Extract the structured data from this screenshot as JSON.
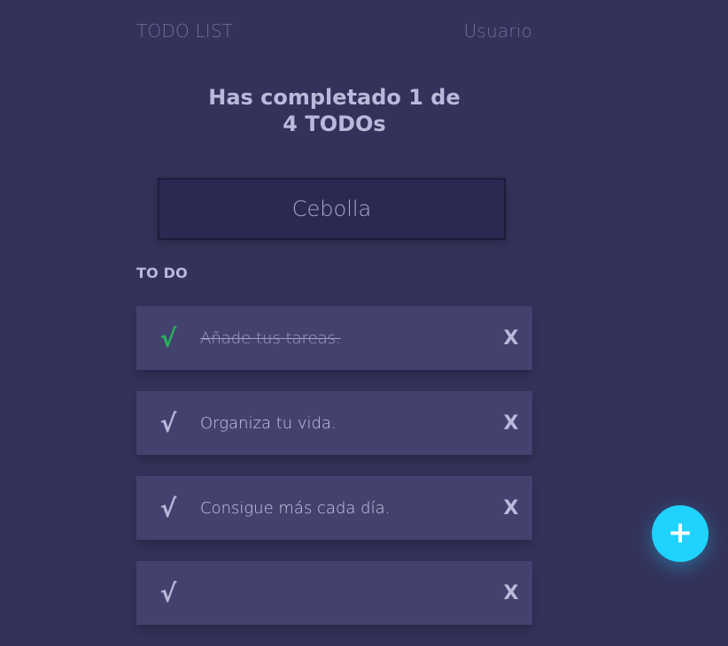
{
  "header": {
    "brand": "TODO LIST",
    "user": "Usuario"
  },
  "summary": {
    "title": "Has completado 1 de 4 TODOs",
    "completed": 1,
    "total": 4
  },
  "search": {
    "value": "Cebolla",
    "placeholder": ""
  },
  "todo": {
    "section_label": "TO DO",
    "items": [
      {
        "label": "Añade tus tareas.",
        "completed": true,
        "check_symbol": "√",
        "delete_symbol": "X"
      },
      {
        "label": "Organiza tu vida.",
        "completed": false,
        "check_symbol": "√",
        "delete_symbol": "X"
      },
      {
        "label": "Consigue más cada día.",
        "completed": false,
        "check_symbol": "√",
        "delete_symbol": "X"
      },
      {
        "label": "",
        "completed": false,
        "check_symbol": "√",
        "delete_symbol": "X"
      }
    ]
  },
  "fab": {
    "label": "+",
    "color": "#1fd3ff"
  },
  "colors": {
    "background": "#33325a",
    "card": "#43426e",
    "accent_check": "#27b35b",
    "text": "#c7c7e5"
  }
}
